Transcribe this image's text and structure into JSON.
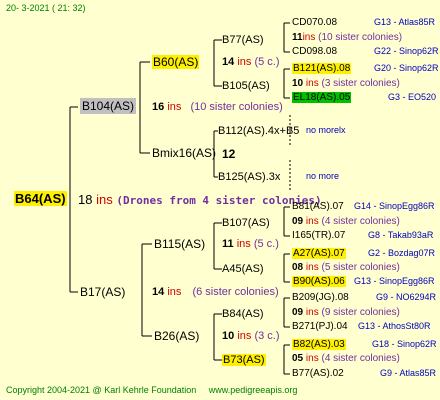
{
  "header": "20- 3-2021 ( 21: 32)",
  "footer": {
    "copyright": "Copyright 2004-2021 @ Karl Kehrle Foundation",
    "url": "www.pedigreeapis.org"
  },
  "root": {
    "name": "B64(AS)",
    "count": "18",
    "ins": "ins",
    "note": "(Drones from 4 sister colonies)"
  },
  "g1": [
    {
      "name": "B104(AS)",
      "count": "16",
      "ins": "ins",
      "note": "(10 sister colonies)"
    },
    {
      "name": "B17(AS)",
      "count": "14",
      "ins": "ins",
      "note": "(6 sister colonies)"
    }
  ],
  "g2": [
    {
      "name": "B60(AS)",
      "count": "14",
      "ins": "ins",
      "note": "(5 c.)"
    },
    {
      "name": "Bmix16(AS)",
      "count": "12"
    },
    {
      "name": "B115(AS)",
      "count": "11",
      "ins": "ins",
      "note": "(5 c.)"
    },
    {
      "name": "B26(AS)",
      "count": "10",
      "ins": "ins",
      "note": "(3 c.)"
    }
  ],
  "g3": [
    {
      "name": "B77(AS)",
      "count": "",
      "ins": "",
      "note": ""
    },
    {
      "name": "B105(AS)",
      "count": "",
      "ins": "",
      "note": ""
    },
    {
      "name": "B112(AS).4x+B5",
      "note": "no morelx"
    },
    {
      "name": "B125(AS).3x",
      "note": "no more"
    },
    {
      "name": "B107(AS)",
      "count": "09",
      "ins": "ins",
      "note": "(4 sister colonies)"
    },
    {
      "name": "A45(AS)",
      "count": "08",
      "ins": "ins",
      "note": "(5 sister colonies)"
    },
    {
      "name": "B84(AS)",
      "count": "09",
      "ins": "ins",
      "note": "(9 sister colonies)"
    },
    {
      "name": "B73(AS)",
      "count": "05",
      "ins": "ins",
      "note": "(4 sister colonies)"
    }
  ],
  "g4": [
    {
      "name": "CD070.08",
      "id": "G13 - Atlas85R"
    },
    {
      "name": "11",
      "ins": "ins",
      "note": "(10 sister colonies)"
    },
    {
      "name": "CD098.08",
      "id": "G22 - Sinop62R"
    },
    {
      "name": "B121(AS).08",
      "id": "G20 - Sinop62R"
    },
    {
      "name": "10",
      "ins": "ins",
      "note": "(3 sister colonies)"
    },
    {
      "name": "EL18(AS).05",
      "id": "G3 - EO520"
    },
    {
      "name": "B81(AS).07",
      "id": "G14 - SinopEgg86R"
    },
    {
      "name": "I165(TR).07",
      "id": "G8 - Takab93aR"
    },
    {
      "name": "A27(AS).07",
      "id": "G2 - Bozdag07R"
    },
    {
      "name": "B90(AS).06",
      "id": "G13 - SinopEgg86R"
    },
    {
      "name": "B209(JG).08",
      "id": "G9 - NO6294R"
    },
    {
      "name": "B271(PJ).04",
      "id": "G13 - AthosSt80R"
    },
    {
      "name": "B82(AS).03",
      "id": "G18 - Sinop62R"
    },
    {
      "name": "B77(AS).02",
      "id": "G9 - Atlas85R"
    }
  ]
}
